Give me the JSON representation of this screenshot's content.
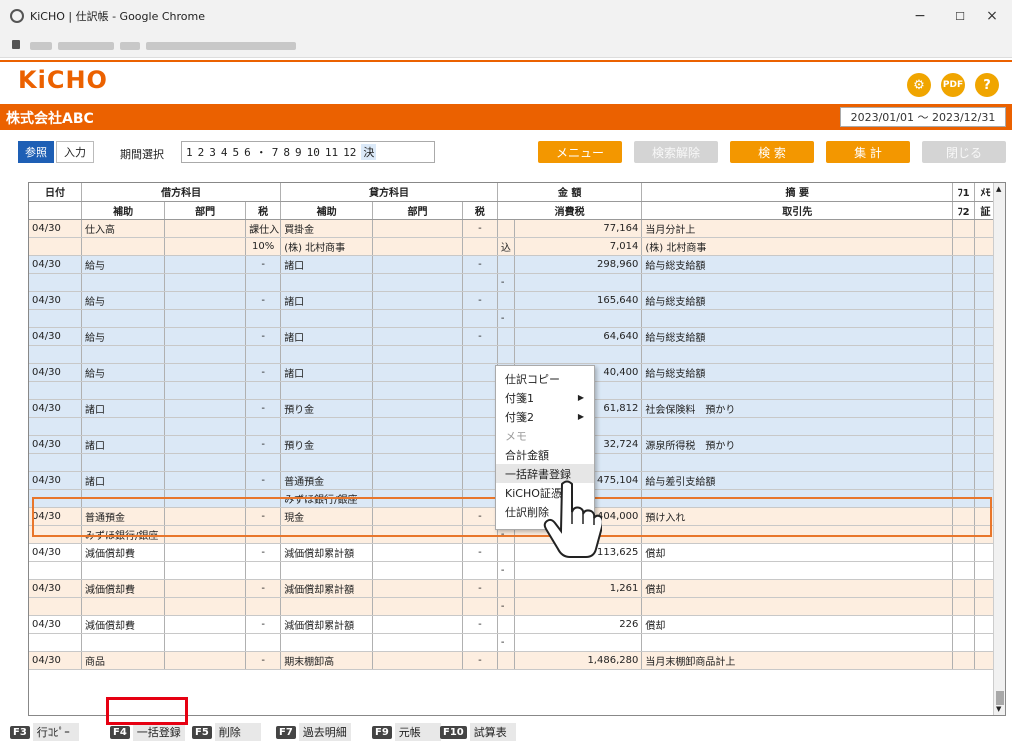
{
  "window": {
    "title": "KiCHO | 仕訳帳 - Google Chrome",
    "min": "−",
    "max": "☐",
    "close": "×"
  },
  "app": {
    "logo": "KiCHO",
    "company": "株式会社ABC",
    "period": "2023/01/01 ～ 2023/12/31"
  },
  "toolbar": {
    "ref": "参照",
    "input": "入力",
    "period_label": "期間選択",
    "months": [
      "1",
      "2",
      "3",
      "4",
      "5",
      "6",
      "・",
      "7",
      "8",
      "9",
      "10",
      "11",
      "12",
      "決"
    ],
    "menu": "メニュー",
    "clear": "検索解除",
    "search": "検 索",
    "total": "集 計",
    "close": "閉じる"
  },
  "header": {
    "r1": [
      "日付",
      "借方科目",
      "",
      "",
      "貸方科目",
      "",
      "",
      "金 額",
      "摘 要",
      "ﾌ1",
      "ﾒﾓ"
    ],
    "r2": [
      "",
      "補助",
      "部門",
      "税",
      "補助",
      "部門",
      "税",
      "消費税",
      "取引先",
      "ﾌ2",
      "証"
    ]
  },
  "rows": [
    {
      "c": "pk",
      "a": [
        "04/30",
        "仕入高",
        "",
        "課仕入",
        "買掛金",
        "",
        "-",
        "",
        "77,164",
        "当月分計上",
        "",
        ""
      ]
    },
    {
      "c": "pk",
      "a": [
        "",
        "",
        "",
        "10%",
        "(株) 北村商事",
        "",
        "",
        "込",
        "7,014",
        "(株) 北村商事",
        "",
        ""
      ]
    },
    {
      "c": "bl",
      "a": [
        "04/30",
        "給与",
        "",
        "-",
        "諸口",
        "",
        "-",
        "",
        "298,960",
        "給与総支給額",
        "",
        ""
      ]
    },
    {
      "c": "bl",
      "a": [
        "",
        "",
        "",
        "",
        "",
        "",
        "",
        "-",
        "",
        "",
        "",
        ""
      ]
    },
    {
      "c": "bl",
      "a": [
        "04/30",
        "給与",
        "",
        "-",
        "諸口",
        "",
        "-",
        "",
        "165,640",
        "給与総支給額",
        "",
        ""
      ]
    },
    {
      "c": "bl",
      "a": [
        "",
        "",
        "",
        "",
        "",
        "",
        "",
        "-",
        "",
        "",
        "",
        ""
      ]
    },
    {
      "c": "bl",
      "a": [
        "04/30",
        "給与",
        "",
        "-",
        "諸口",
        "",
        "-",
        "",
        "64,640",
        "給与総支給額",
        "",
        ""
      ]
    },
    {
      "c": "bl",
      "a": [
        "",
        "",
        "",
        "",
        "",
        "",
        "",
        "",
        "",
        "",
        "",
        ""
      ]
    },
    {
      "c": "bl",
      "a": [
        "04/30",
        "給与",
        "",
        "-",
        "諸口",
        "",
        "",
        "",
        "40,400",
        "給与総支給額",
        "",
        ""
      ]
    },
    {
      "c": "bl",
      "a": [
        "",
        "",
        "",
        "",
        "",
        "",
        "",
        "",
        "",
        "",
        "",
        ""
      ]
    },
    {
      "c": "bl",
      "a": [
        "04/30",
        "諸口",
        "",
        "-",
        "預り金",
        "",
        "",
        "",
        "61,812",
        "社会保険料　預かり",
        "",
        ""
      ]
    },
    {
      "c": "bl",
      "a": [
        "",
        "",
        "",
        "",
        "",
        "",
        "",
        "",
        "",
        "",
        "",
        ""
      ]
    },
    {
      "c": "bl",
      "a": [
        "04/30",
        "諸口",
        "",
        "-",
        "預り金",
        "",
        "",
        "",
        "32,724",
        "源泉所得税　預かり",
        "",
        ""
      ]
    },
    {
      "c": "bl",
      "a": [
        "",
        "",
        "",
        "",
        "",
        "",
        "",
        "",
        "",
        "",
        "",
        ""
      ]
    },
    {
      "c": "bl",
      "a": [
        "04/30",
        "諸口",
        "",
        "-",
        "普通預金",
        "",
        "",
        "",
        "475,104",
        "給与差引支給額",
        "",
        ""
      ]
    },
    {
      "c": "bl",
      "a": [
        "",
        "",
        "",
        "",
        "みずほ銀行/銀座",
        "",
        "",
        "",
        "",
        "",
        "",
        ""
      ]
    },
    {
      "c": "pk",
      "a": [
        "04/30",
        "普通預金",
        "",
        "-",
        "現金",
        "",
        "-",
        "",
        "404,000",
        "預け入れ",
        "",
        ""
      ]
    },
    {
      "c": "pk",
      "a": [
        "",
        "みずほ銀行/銀座",
        "",
        "",
        "",
        "",
        "",
        "-",
        "",
        "",
        "",
        ""
      ]
    },
    {
      "c": "wh",
      "a": [
        "04/30",
        "減価償却費",
        "",
        "-",
        "減価償却累計額",
        "",
        "-",
        "",
        "113,625",
        "償却",
        "",
        ""
      ]
    },
    {
      "c": "wh",
      "a": [
        "",
        "",
        "",
        "",
        "",
        "",
        "",
        "-",
        "",
        "",
        "",
        ""
      ]
    },
    {
      "c": "pk",
      "a": [
        "04/30",
        "減価償却費",
        "",
        "-",
        "減価償却累計額",
        "",
        "-",
        "",
        "1,261",
        "償却",
        "",
        ""
      ]
    },
    {
      "c": "pk",
      "a": [
        "",
        "",
        "",
        "",
        "",
        "",
        "",
        "-",
        "",
        "",
        "",
        ""
      ]
    },
    {
      "c": "wh",
      "a": [
        "04/30",
        "減価償却費",
        "",
        "-",
        "減価償却累計額",
        "",
        "-",
        "",
        "226",
        "償却",
        "",
        ""
      ]
    },
    {
      "c": "wh",
      "a": [
        "",
        "",
        "",
        "",
        "",
        "",
        "",
        "-",
        "",
        "",
        "",
        ""
      ]
    },
    {
      "c": "pk",
      "a": [
        "04/30",
        "商品",
        "",
        "-",
        "期末棚卸高",
        "",
        "-",
        "",
        "1,486,280",
        "当月末棚卸商品計上",
        "",
        ""
      ]
    }
  ],
  "context_menu": [
    {
      "label": "仕訳コピー"
    },
    {
      "label": "付箋1",
      "sub": "▶"
    },
    {
      "label": "付箋2",
      "sub": "▶"
    },
    {
      "label": "メモ",
      "dis": true
    },
    {
      "label": "合計金額"
    },
    {
      "label": "一括辞書登録",
      "hov": true
    },
    {
      "label": "KiCHO証憑削"
    },
    {
      "label": "仕訳削除"
    }
  ],
  "fkeys": [
    {
      "k": "F3",
      "l": "行ｺﾋﾟｰ"
    },
    {
      "k": "F4",
      "l": "一括登録"
    },
    {
      "k": "F5",
      "l": "削除"
    },
    {
      "k": "F7",
      "l": "過去明細"
    },
    {
      "k": "F9",
      "l": "元帳"
    },
    {
      "k": "F10",
      "l": "試算表"
    }
  ],
  "colors": {
    "accent": "#eb6100",
    "highlight": "#e60012"
  }
}
